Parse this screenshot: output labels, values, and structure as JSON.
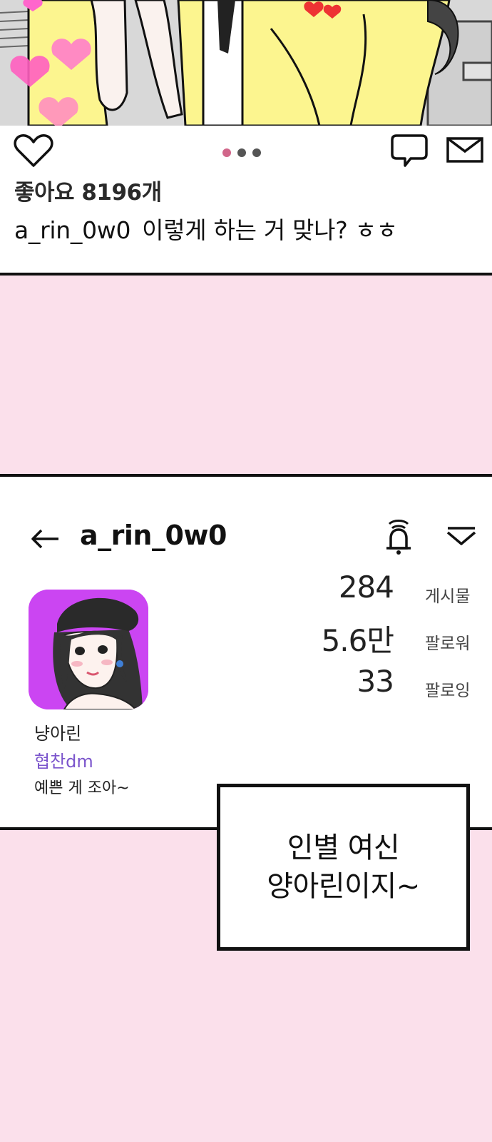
{
  "post": {
    "likes_text": "좋아요 8196개",
    "caption_user": "a_rin_0w0",
    "caption_text": "이렇게 하는 거 맞나? ㅎㅎ",
    "carousel_total": 3,
    "carousel_active": 1
  },
  "profile": {
    "username": "a_rin_0w0",
    "stats": [
      {
        "value": "284",
        "label": "게시물"
      },
      {
        "value": "5.6만",
        "label": "팔로워"
      },
      {
        "value": "33",
        "label": "팔로잉"
      }
    ],
    "display_name": "냥아린",
    "sponsor": "협찬dm",
    "bio": "예쁜 게 조아~"
  },
  "narration": {
    "line1": "인별 여신",
    "line2": "양아린이지~"
  },
  "colors": {
    "background_pink": "#fbe0eb",
    "avatar_purple": "#cb45f2",
    "accent_purple_text": "#7b55cc",
    "active_dot": "#d1668a"
  },
  "icons": [
    "heart-icon",
    "comment-icon",
    "message-icon",
    "back-arrow-icon",
    "bell-icon",
    "chevron-menu-icon"
  ]
}
